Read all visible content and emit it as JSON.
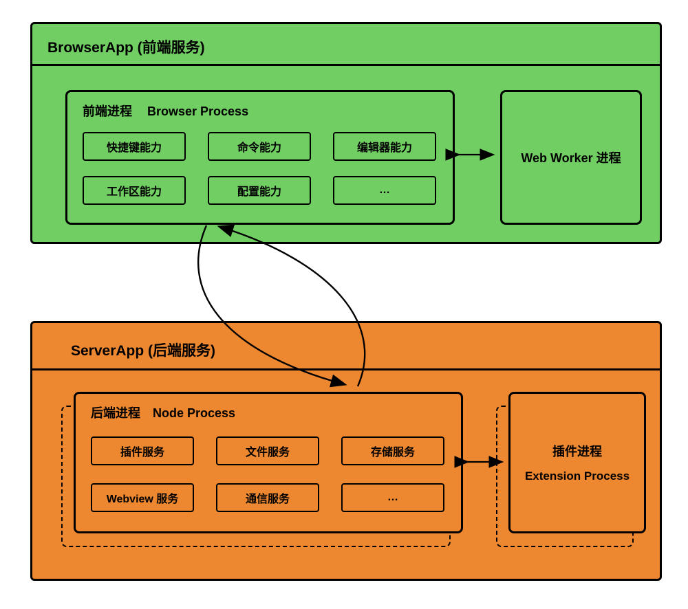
{
  "browserApp": {
    "title": "BrowserApp (前端服务)",
    "process": {
      "cnLabel": "前端进程",
      "enLabel": "Browser Process",
      "row1": [
        "快捷键能力",
        "命令能力",
        "编辑器能力"
      ],
      "row2": [
        "工作区能力",
        "配置能力",
        "…"
      ]
    },
    "webWorker": "Web Worker 进程"
  },
  "serverApp": {
    "title": "ServerApp (后端服务)",
    "process": {
      "cnLabel": "后端进程",
      "enLabel": "Node Process",
      "row1": [
        "插件服务",
        "文件服务",
        "存储服务"
      ],
      "row2": [
        "Webview 服务",
        "通信服务",
        "…"
      ]
    },
    "extProcess": {
      "cnLabel": "插件进程",
      "enLabel": "Extension Process"
    }
  }
}
